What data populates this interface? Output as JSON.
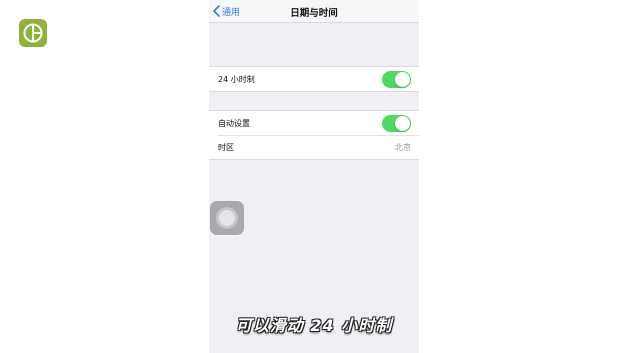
{
  "brand": {
    "logo_icon": "brand-logo-icon",
    "logo_color": "#8db33a"
  },
  "navbar": {
    "back_label": "通用",
    "back_icon": "chevron-left-icon",
    "title": "日期与时间",
    "accent": "#2f7cf6"
  },
  "settings": {
    "time_format": {
      "label": "24 小时制",
      "enabled": true
    },
    "auto_set": {
      "label": "自动设置",
      "enabled": true
    },
    "timezone": {
      "label": "时区",
      "value": "北京"
    }
  },
  "toggle_on_color": "#4cd964",
  "assistive_touch": {
    "icon": "assistive-touch-icon"
  },
  "caption": "可以滑动 24 小时制"
}
